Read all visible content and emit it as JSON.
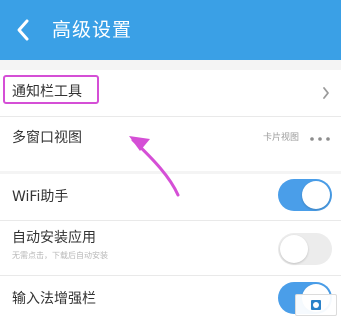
{
  "header": {
    "title": "高级设置"
  },
  "settings": [
    {
      "label": "通知栏工具"
    },
    {
      "label": "多窗口视图",
      "value": "卡片视图",
      "more_label": "···"
    },
    {
      "label": "WiFi助手",
      "toggle": "on"
    },
    {
      "label": "自动安装应用",
      "hint": "无需点击，下载后自动安装",
      "toggle": "off"
    },
    {
      "label": "输入法增强栏",
      "toggle": "on"
    }
  ],
  "colors": {
    "header": "#3aa0e6",
    "toggle_on": "#4a9ee9",
    "highlight": "#d54fd6",
    "arrow": "#d54fd6"
  }
}
